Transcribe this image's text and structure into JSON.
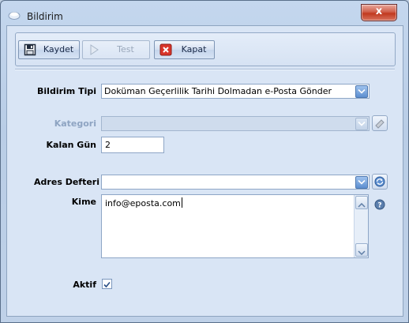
{
  "window": {
    "title": "Bildirim",
    "close_label": "x"
  },
  "toolbar": {
    "save_label": "Kaydet",
    "test_label": "Test",
    "close_label": "Kapat"
  },
  "form": {
    "notification_type": {
      "label": "Bildirim Tipi",
      "value": "Doküman Geçerlilik Tarihi Dolmadan e-Posta Gönder"
    },
    "category": {
      "label": "Kategori",
      "value": ""
    },
    "remaining_days": {
      "label": "Kalan Gün",
      "value": "2"
    },
    "address_book": {
      "label": "Adres Defteri",
      "value": ""
    },
    "to": {
      "label": "Kime",
      "value": "info@eposta.com"
    },
    "active": {
      "label": "Aktif",
      "checked": true
    }
  },
  "colors": {
    "accent": "#5d8fd0",
    "client_bg": "#d9e5f5",
    "close_red": "#c1391f",
    "disabled_text": "#8ea4c2"
  }
}
